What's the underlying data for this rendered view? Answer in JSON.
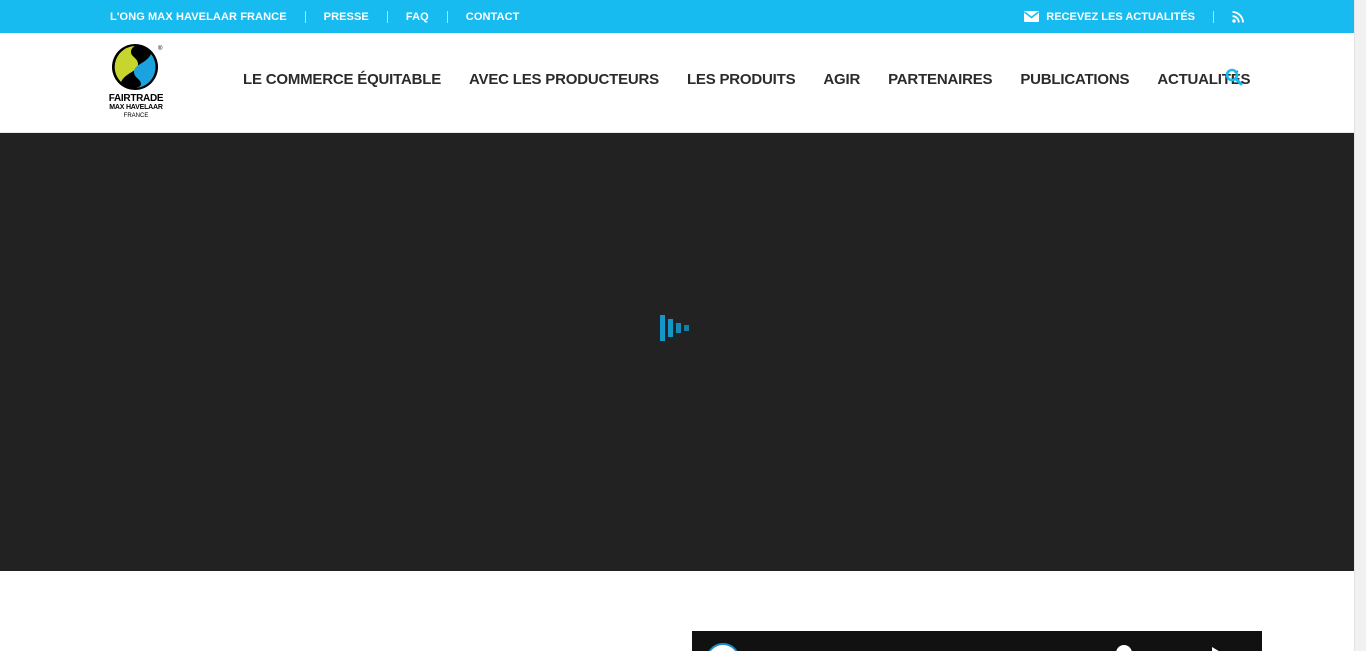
{
  "topbar": {
    "links": [
      "L'ONG MAX HAVELAAR FRANCE",
      "PRESSE",
      "FAQ",
      "CONTACT"
    ],
    "newsletter_label": "RECEVEZ LES ACTUALITÉS",
    "mail_icon": "envelope-icon",
    "rss_icon": "rss-icon",
    "background": "#18bbf0"
  },
  "logo": {
    "line1": "FAIRTRADE",
    "line2": "MAX HAVELAAR",
    "line3": "FRANCE"
  },
  "nav": {
    "items": [
      "LE COMMERCE ÉQUITABLE",
      "AVEC LES PRODUCTEURS",
      "LES PRODUITS",
      "AGIR",
      "PARTENAIRES",
      "PUBLICATIONS",
      "ACTUALITÉS"
    ],
    "search_icon": "search-icon"
  },
  "hero": {
    "background": "#222222",
    "loader_icon": "loading-bars-icon"
  },
  "accent": "#1496c8"
}
